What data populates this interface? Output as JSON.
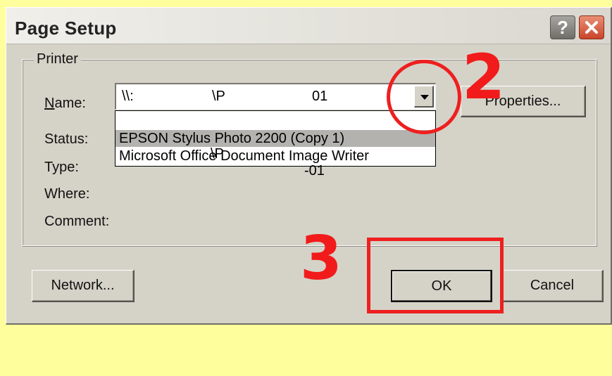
{
  "dialog": {
    "title": "Page Setup",
    "help_glyph": "?",
    "close_icon": "close-icon"
  },
  "printer_group": {
    "legend": "Printer",
    "labels": {
      "name": "Name:",
      "status": "Status:",
      "type": "Type:",
      "where": "Where:",
      "comment": "Comment:"
    },
    "name_combo": {
      "selected_prefix": "\\\\:",
      "selected_mid": "\\P",
      "selected_suffix": "01"
    },
    "dropdown_items": [
      {
        "prefix": "\\\\",
        "mid": "\\P",
        "suffix": "-01"
      },
      {
        "label": "EPSON Stylus Photo 2200 (Copy 1)"
      },
      {
        "label": "Microsoft Office Document Image Writer"
      }
    ],
    "properties_label": "Properties..."
  },
  "buttons": {
    "network": "Network...",
    "ok": "OK",
    "cancel": "Cancel"
  },
  "annotations": {
    "step2": "2",
    "step3": "3",
    "color": "#ee1f1f"
  },
  "colors": {
    "dialog_face": "#d5d3c8",
    "background": "#fefe9c",
    "selection": "#b3b2ae"
  }
}
